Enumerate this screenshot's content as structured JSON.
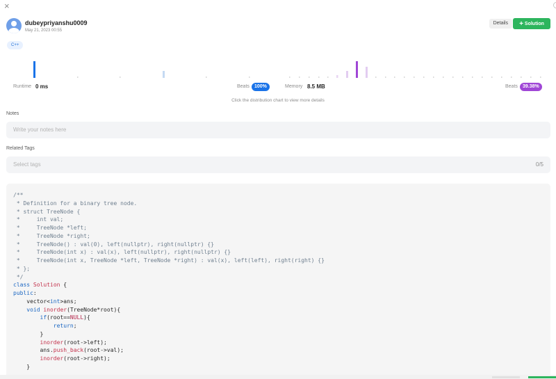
{
  "header": {
    "close_icon": "×",
    "username": "dubeypriyanshu0009",
    "timestamp": "May 21, 2023 00:55",
    "details_label": "Details",
    "solution_label": "Solution",
    "solution_icon": "+"
  },
  "language_tag": "C++",
  "colors": {
    "accent_blue": "#1a73e8",
    "accent_purple": "#a046d6",
    "solution_green": "#2db55d"
  },
  "runtime": {
    "label": "Runtime",
    "value": "0 ms",
    "beats_label": "Beats",
    "beats_value": "100%"
  },
  "memory": {
    "label": "Memory",
    "value": "8.5 MB",
    "beats_label": "Beats",
    "beats_value": "39.38%"
  },
  "chart_hint": "Click the distribution chart to view more details",
  "notes": {
    "label": "Notes",
    "placeholder": "Write your notes here"
  },
  "related_tags": {
    "label": "Related Tags",
    "placeholder": "Select tags",
    "count": "0/5"
  },
  "code_lines": [
    [
      [
        "c",
        "/**"
      ]
    ],
    [
      [
        "c",
        " * Definition for a binary tree node."
      ]
    ],
    [
      [
        "c",
        " * struct TreeNode {"
      ]
    ],
    [
      [
        "c",
        " *     int val;"
      ]
    ],
    [
      [
        "c",
        " *     TreeNode *left;"
      ]
    ],
    [
      [
        "c",
        " *     TreeNode *right;"
      ]
    ],
    [
      [
        "c",
        " *     TreeNode() : val(0), left(nullptr), right(nullptr) {}"
      ]
    ],
    [
      [
        "c",
        " *     TreeNode(int x) : val(x), left(nullptr), right(nullptr) {}"
      ]
    ],
    [
      [
        "c",
        " *     TreeNode(int x, TreeNode *left, TreeNode *right) : val(x), left(left), right(right) {}"
      ]
    ],
    [
      [
        "c",
        " * };"
      ]
    ],
    [
      [
        "c",
        " */"
      ]
    ],
    [
      [
        "k",
        "class"
      ],
      [
        "p",
        " "
      ],
      [
        "cls",
        "Solution"
      ],
      [
        "p",
        " {"
      ]
    ],
    [
      [
        "k",
        "public"
      ],
      [
        "p",
        ":"
      ]
    ],
    [
      [
        "p",
        "    vector<"
      ],
      [
        "k",
        "int"
      ],
      [
        "p",
        ">ans;"
      ]
    ],
    [
      [
        "p",
        "    "
      ],
      [
        "k",
        "void"
      ],
      [
        "p",
        " "
      ],
      [
        "f",
        "inorder"
      ],
      [
        "p",
        "(TreeNode*root){"
      ]
    ],
    [
      [
        "p",
        "        "
      ],
      [
        "k",
        "if"
      ],
      [
        "p",
        "(root=="
      ],
      [
        "n",
        "NULL"
      ],
      [
        "p",
        "){"
      ]
    ],
    [
      [
        "p",
        "            "
      ],
      [
        "k",
        "return"
      ],
      [
        "p",
        ";"
      ]
    ],
    [
      [
        "p",
        "        }"
      ]
    ],
    [
      [
        "p",
        "        "
      ],
      [
        "f",
        "inorder"
      ],
      [
        "p",
        "(root->left);"
      ]
    ],
    [
      [
        "p",
        "        ans."
      ],
      [
        "f",
        "push_back"
      ],
      [
        "p",
        "(root->val);"
      ]
    ],
    [
      [
        "p",
        "        "
      ],
      [
        "f",
        "inorder"
      ],
      [
        "p",
        "(root->right);"
      ]
    ],
    [
      [
        "p",
        "    }"
      ]
    ]
  ]
}
